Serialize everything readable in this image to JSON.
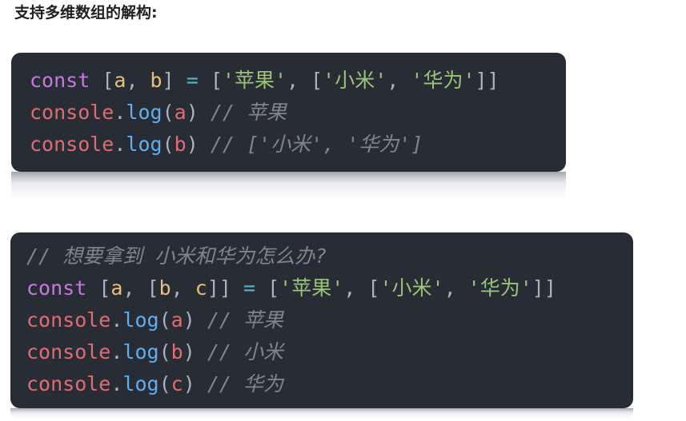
{
  "heading": "支持多维数组的解构:",
  "block1": {
    "line1": {
      "kw": "const",
      "open_bracket": " [",
      "a": "a",
      "comma": ", ",
      "b": "b",
      "close_bracket": "]",
      "eq": " = ",
      "arr_open": "[",
      "s1": "'苹果'",
      "sep1": ", ",
      "inner_open": "[",
      "s2": "'小米'",
      "sep2": ", ",
      "s3": "'华为'",
      "arr_close": "]]"
    },
    "line2": {
      "obj": "console",
      "dot": ".",
      "fn": "log",
      "open": "(",
      "arg": "a",
      "close": ")",
      "comment": " // 苹果"
    },
    "line3": {
      "obj": "console",
      "dot": ".",
      "fn": "log",
      "open": "(",
      "arg": "b",
      "close": ")",
      "comment": " // ['小米', '华为']"
    }
  },
  "block2": {
    "line1": {
      "comment": "// 想要拿到 小米和华为怎么办?"
    },
    "line2": {
      "kw": "const",
      "open_bracket": " [",
      "a": "a",
      "comma1": ", ",
      "inner_open": "[",
      "b": "b",
      "comma2": ", ",
      "c": "c",
      "close_bracket": "]]",
      "eq": " = ",
      "arr_open": "[",
      "s1": "'苹果'",
      "sep1": ", ",
      "inner_arr_open": "[",
      "s2": "'小米'",
      "sep2": ", ",
      "s3": "'华为'",
      "arr_close": "]]"
    },
    "line3": {
      "obj": "console",
      "dot": ".",
      "fn": "log",
      "open": "(",
      "arg": "a",
      "close": ")",
      "comment": " // 苹果"
    },
    "line4": {
      "obj": "console",
      "dot": ".",
      "fn": "log",
      "open": "(",
      "arg": "b",
      "close": ")",
      "comment": " // 小米"
    },
    "line5": {
      "obj": "console",
      "dot": ".",
      "fn": "log",
      "open": "(",
      "arg": "c",
      "close": ")",
      "comment": " // 华为"
    }
  },
  "colors": {
    "background": "#282c34",
    "keyword": "#c678dd",
    "variable": "#e5c07b",
    "operator": "#56b6c2",
    "string": "#98c379",
    "object": "#e06c75",
    "function": "#61afef",
    "comment": "#7f848e",
    "punctuation": "#abb2bf"
  }
}
